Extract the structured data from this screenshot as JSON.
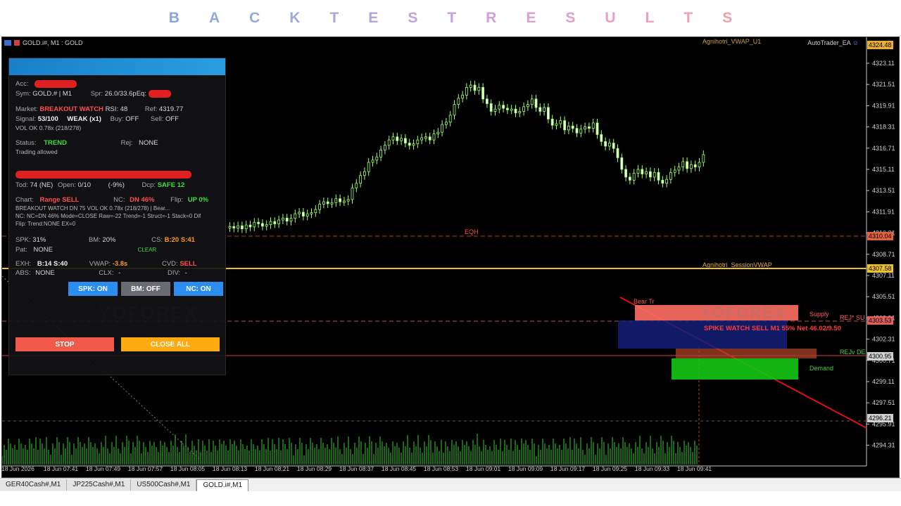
{
  "banner": {
    "letters": [
      "B",
      "A",
      "C",
      "K",
      "T",
      "E",
      "S",
      "T",
      "R",
      "E",
      "S",
      "U",
      "L",
      "T",
      "S"
    ],
    "colors": [
      "#8aa6d8",
      "#90a8da",
      "#98a8dc",
      "#a0a8dc",
      "#aaa6dc",
      "#b4a4dc",
      "#c0a2dc",
      "#c8a0dc",
      "#d0a0d8",
      "#d8a0d4",
      "#e0a0cc",
      "#e6a0c4",
      "#eaa0bc",
      "#eea0b4",
      "#f0a0ac"
    ]
  },
  "chart": {
    "title_left": "GOLD.i#, M1 : GOLD",
    "title_right": "AutoTrader_EA",
    "indicator_top": "Agnihotri_VWAP_U1",
    "indicator_mid": "Agnihotri_SessionVWAP",
    "price_labels": [
      "4323.11",
      "4321.51",
      "4319.91",
      "4318.31",
      "4316.71",
      "4315.11",
      "4313.51",
      "4311.91",
      "4310.31",
      "4308.71",
      "4307.11",
      "4305.51",
      "4303.91",
      "4302.31",
      "4300.71",
      "4299.11",
      "4297.51",
      "4295.91",
      "4294.31"
    ],
    "price_tags": [
      {
        "text": "4324.48",
        "color": "#e8b030"
      },
      {
        "text": "4310.04",
        "color": "#e06040"
      },
      {
        "text": "4307.58",
        "color": "#e8c030"
      },
      {
        "text": "4303.53",
        "color": "#e06060"
      },
      {
        "text": "4300.95",
        "color": "#d0d0d0"
      },
      {
        "text": "4296.21",
        "color": "#d0d0d0"
      }
    ],
    "time_labels": [
      "18 Jun 2026",
      "18 Jun 07:41",
      "18 Jun 07:49",
      "18 Jun 07:57",
      "18 Jun 08:05",
      "18 Jun 08:13",
      "18 Jun 08:21",
      "18 Jun 08:29",
      "18 Jun 08:37",
      "18 Jun 08:45",
      "18 Jun 08:53",
      "18 Jun 09:01",
      "18 Jun 09:09",
      "18 Jun 09:17",
      "18 Jun 09:25",
      "18 Jun 09:33",
      "18 Jun 09:41"
    ],
    "zone_labels": {
      "supply": "Supply",
      "demand": "Demand",
      "bear": "Bear Tr",
      "eqh": "EQH",
      "rej_su": "REJ* SU",
      "rej_de": "REJv DE",
      "spike": "SPIKE WATCH SELL M1 55% Net 46.02/9.50"
    },
    "watermark": "YOFOREX"
  },
  "panel": {
    "acc_label": "Acc:",
    "sym_label": "Sym:",
    "sym_value": "GOLD.# | M1",
    "spr_label": "Spr:",
    "spr_value": "26.0/33.6pEq:",
    "market_label": "Market:",
    "market_value": "BREAKOUT WATCH",
    "rsi_value": "RSI: 48",
    "ref_label": "Ref:",
    "ref_value": "4319.77",
    "signal_label": "Signal:",
    "signal_value": "53/100",
    "signal_strength": "WEAK (x1)",
    "buy_label": "Buy:",
    "buy_value": "OFF",
    "sell_label": "Sell:",
    "sell_value": "OFF",
    "vol_text": "VOL OK 0.78x (218/278)",
    "status_label": "Status:",
    "status_value": "TREND",
    "rej_label": "Rej:",
    "rej_value": "NONE",
    "trading_text": "Trading allowed",
    "tod_label": "Tod:",
    "tod_value": "74 (NE)",
    "open_label": "Open:",
    "open_value": "0/10",
    "pct_value": "(-9%)",
    "dcp_label": "Dcp:",
    "dcp_value": "SAFE 12",
    "chart_label": "Chart:",
    "chart_value": "Range SELL",
    "nc_label": "NC:",
    "nc_value": "DN 46%",
    "flip_label": "Flip:",
    "flip_value": "UP 0%",
    "detail1": "BREAKOUT WATCH DN 75 VOL OK 0.78x (218/278) | Bear...",
    "detail2": "NC: NC=DN 46% Mode=CLOSE Raw=-22 Trend=-1 Struct=-1 Stack=0 Dif",
    "detail3": "Flip: Trend:NONE EX=0",
    "spk_label": "SPK:",
    "spk_value": "31%",
    "bm_label": "BM:",
    "bm_value": "20%",
    "cs_label": "CS:",
    "cs_value": "B:20 S:41",
    "pat_label": "Pat:",
    "pat_value": "NONE",
    "clear_value": "CLEAR",
    "exh_label": "EXH:",
    "exh_value": "B:14 S:40",
    "vwap_label": "VWAP:",
    "vwap_value": "-3.8s",
    "cvd_label": "CVD:",
    "cvd_value": "SELL",
    "abs_label": "ABS:",
    "abs_value": "NONE",
    "clx_label": "CLX:",
    "clx_value": "-",
    "div_label": "DIV:",
    "div_value": "-",
    "btn_spk": "SPK: ON",
    "btn_bm": "BM: OFF",
    "btn_nc": "NC: ON",
    "btn_stop": "STOP",
    "btn_close_all": "CLOSE ALL"
  },
  "tabs": [
    {
      "label": "GER40Cash#,M1",
      "active": false
    },
    {
      "label": "JP225Cash#,M1",
      "active": false
    },
    {
      "label": "US500Cash#,M1",
      "active": false
    },
    {
      "label": "GOLD.i#,M1",
      "active": true
    }
  ]
}
